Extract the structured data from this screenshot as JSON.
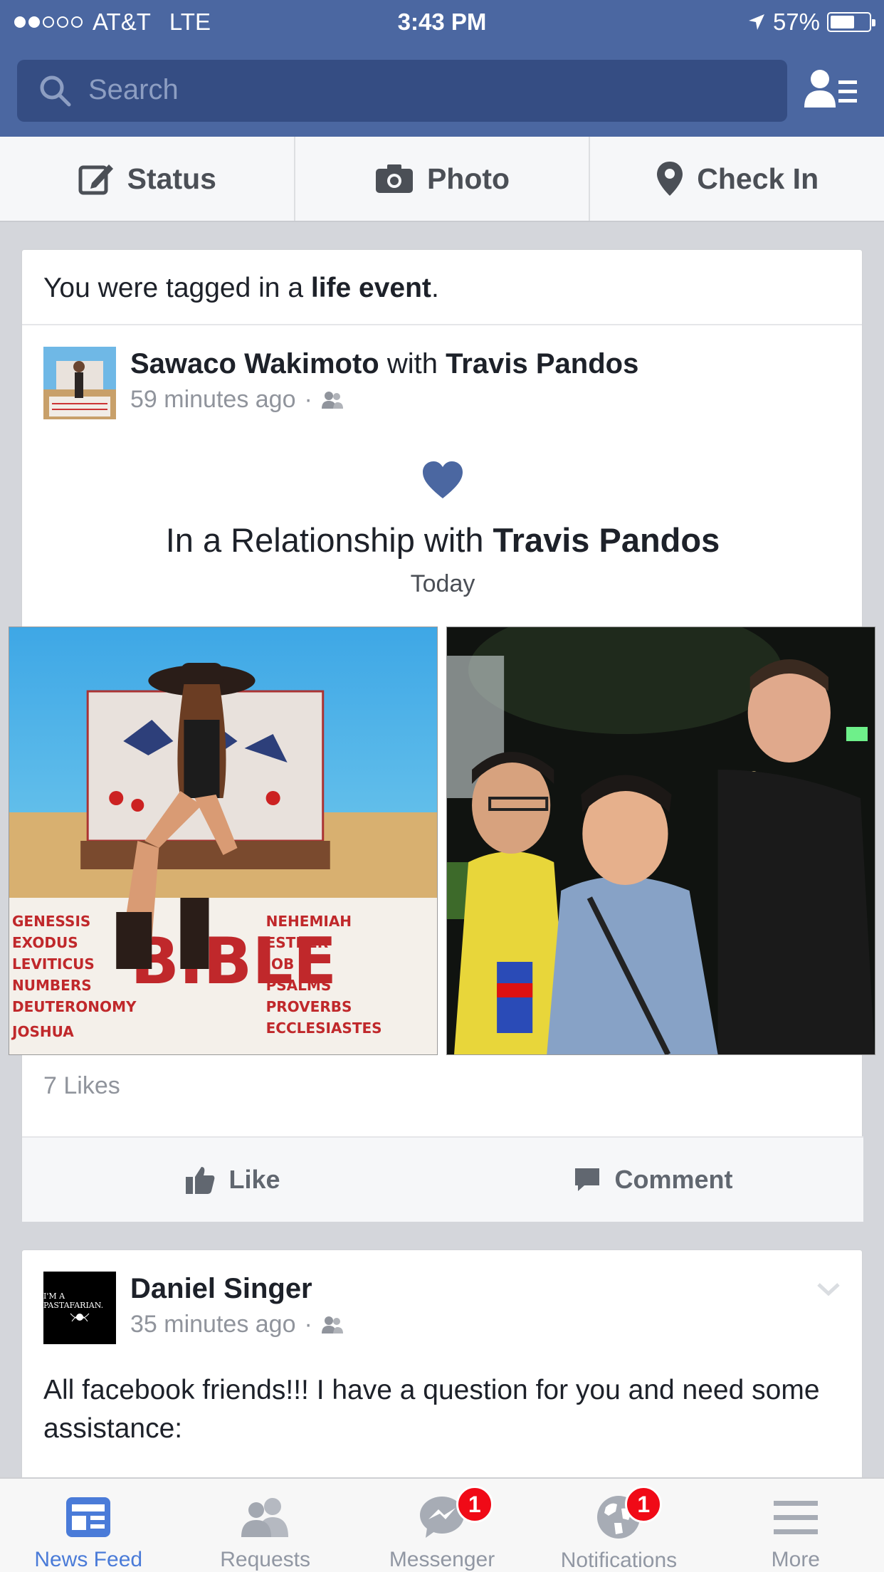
{
  "status_bar": {
    "carrier": "AT&T",
    "network": "LTE",
    "time": "3:43 PM",
    "battery": "57%",
    "signal_bars_filled": 2,
    "signal_bars_total": 5
  },
  "header": {
    "search_placeholder": "Search",
    "colors": {
      "primary": "#4b67a1",
      "search_bg": "#354d83"
    }
  },
  "composer": {
    "status_label": "Status",
    "photo_label": "Photo",
    "checkin_label": "Check In"
  },
  "post1": {
    "tag_prefix": "You were tagged in a ",
    "tag_bold": "life event",
    "tag_suffix": ".",
    "author": "Sawaco Wakimoto",
    "with_word": " with ",
    "with_name": "Travis Pandos",
    "time": "59 minutes ago",
    "event_prefix": "In a Relationship with ",
    "event_name": "Travis Pandos",
    "event_date": "Today",
    "likes": "7 Likes",
    "like_label": "Like",
    "comment_label": "Comment"
  },
  "post2": {
    "author": "Daniel Singer",
    "time": "35 minutes ago",
    "avatar_text": "I'M A PASTAFARIAN.",
    "text": "All facebook friends!!! I have a question for you and need some assistance:"
  },
  "tabbar": {
    "tabs": [
      {
        "label": "News Feed",
        "icon": "news-feed-icon",
        "active": true
      },
      {
        "label": "Requests",
        "icon": "friend-requests-icon"
      },
      {
        "label": "Messenger",
        "icon": "messenger-icon",
        "badge": "1"
      },
      {
        "label": "Notifications",
        "icon": "globe-icon",
        "badge": "1"
      },
      {
        "label": "More",
        "icon": "menu-icon"
      }
    ]
  }
}
